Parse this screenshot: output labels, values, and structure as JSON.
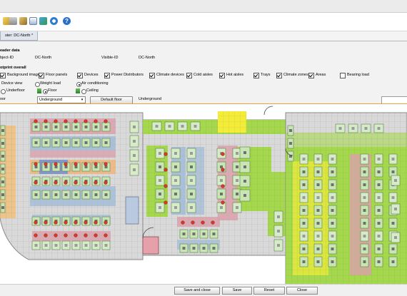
{
  "tab": {
    "label": "ster: DC-North *",
    "close": "✕"
  },
  "header": {
    "section_title": "eader data",
    "object_id_label": "bject-ID",
    "object_id_value": "DC-North",
    "visible_id_label": "Visible-ID",
    "visible_id_value": "DC-North",
    "footprint_title": "otprint overall"
  },
  "layers": [
    {
      "label": "Background image",
      "checked": true
    },
    {
      "label": "Floor panels",
      "checked": true
    },
    {
      "label": "Devices",
      "checked": true
    },
    {
      "label": "Power Distributors",
      "checked": true
    },
    {
      "label": "Climate devices",
      "checked": true
    },
    {
      "label": "Cold aisles",
      "checked": true
    },
    {
      "label": "Hot aisles",
      "checked": true
    },
    {
      "label": "Trays",
      "checked": true
    },
    {
      "label": "Climate zones",
      "checked": true
    },
    {
      "label": "Areas",
      "checked": true
    },
    {
      "label": "Bearing load",
      "checked": false
    }
  ],
  "view": {
    "device_view_label": "Device view",
    "weight_load_label": "Weight load",
    "air_conditioning_label": "Air conditioning",
    "underfloor_label": "Underfloor",
    "floor_label": "Floor",
    "ceiling_label": "Ceiling",
    "floor_select_label": "oor",
    "floor_select_value": "Underground",
    "default_floor_button": "Default floor",
    "floor_name": "Underground"
  },
  "footer": {
    "save_close": "Save and close",
    "save": "Save",
    "reset": "Reset",
    "close": "Close"
  },
  "colors": {
    "cold_aisle": "#9fb9d6",
    "hot_aisle": "#d9a1ac",
    "climate_zone": "#a6d84f",
    "area_yellow": "#f3ec3a",
    "area_orange": "#f0b070",
    "rack": "#c8e6b4",
    "device_red": "#d23a2a"
  }
}
